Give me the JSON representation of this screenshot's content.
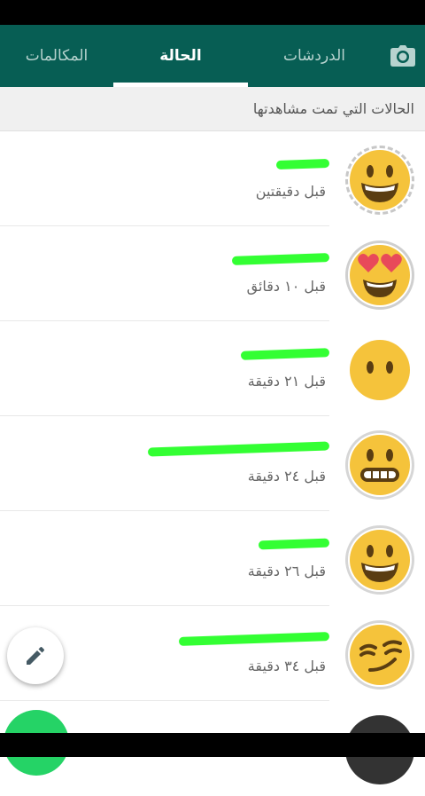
{
  "tabs": {
    "calls": "المكالمات",
    "status": "الحالة",
    "chats": "الدردشات",
    "camera_icon": "camera-icon"
  },
  "section_header": "الحالات التي تمت مشاهدتها",
  "statuses": [
    {
      "name": "",
      "time": "قبل دقيقتين",
      "avatar": "grinning-face"
    },
    {
      "name": "",
      "time": "قبل ١٠ دقائق",
      "avatar": "heart-eyes-face"
    },
    {
      "name": "",
      "time": "قبل ٢١ دقيقة",
      "avatar": "neutral-face"
    },
    {
      "name": "",
      "time": "قبل ٢٤ دقيقة",
      "avatar": "grimacing-face"
    },
    {
      "name": "",
      "time": "قبل ٢٦ دقيقة",
      "avatar": "grinning-face"
    },
    {
      "name": "",
      "time": "قبل ٣٤ دقيقة",
      "avatar": "smirking-face"
    }
  ],
  "colors": {
    "header": "#075e54",
    "accent": "#25d366",
    "emoji": "#f5c33b"
  }
}
